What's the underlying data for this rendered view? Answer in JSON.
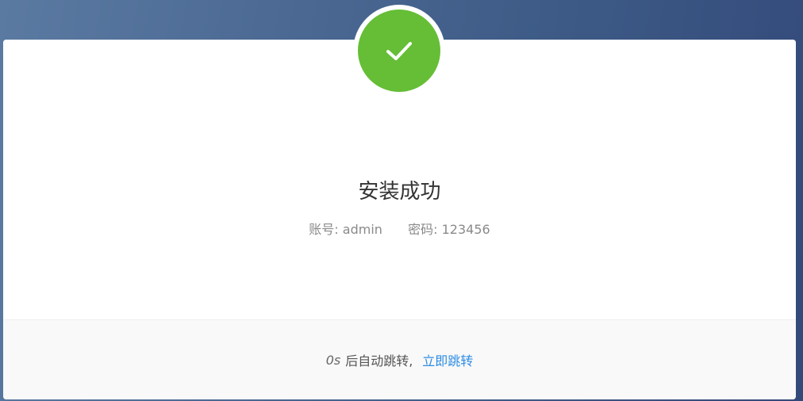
{
  "status": {
    "icon": "check-icon",
    "color": "#65be36",
    "title": "安装成功"
  },
  "credentials": {
    "account_label": "账号:",
    "account_value": "admin",
    "password_label": "密码:",
    "password_value": "123456"
  },
  "footer": {
    "countdown": "0s",
    "redirect_text": "后自动跳转,",
    "redirect_link": "立即跳转",
    "link_color": "#2d8ce3"
  }
}
